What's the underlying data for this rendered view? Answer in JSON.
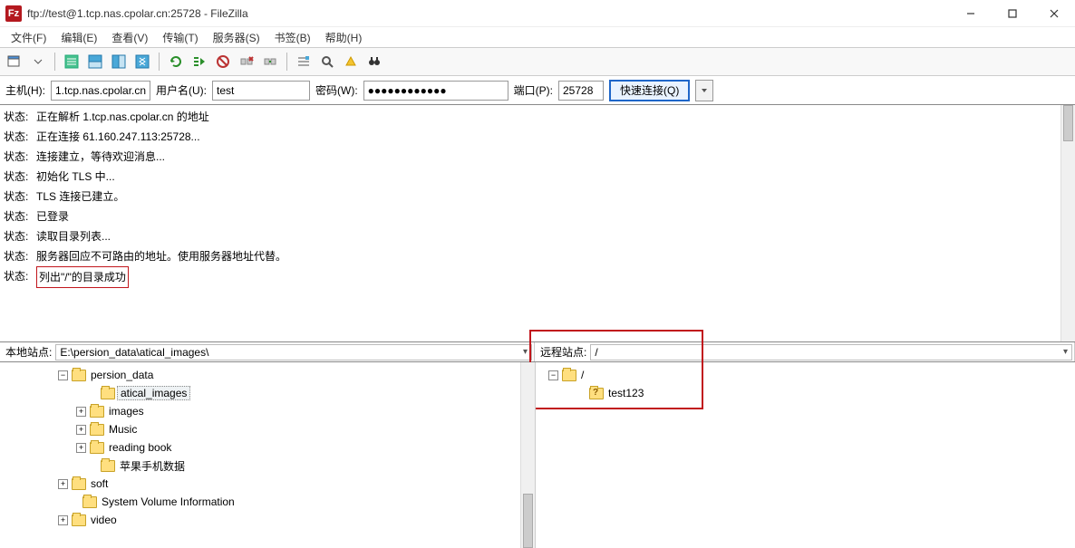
{
  "window": {
    "title": "ftp://test@1.tcp.nas.cpolar.cn:25728 - FileZilla",
    "logo": "Fz"
  },
  "menu": {
    "file": "文件(F)",
    "edit": "编辑(E)",
    "view": "查看(V)",
    "transfer": "传输(T)",
    "server": "服务器(S)",
    "bookmarks": "书签(B)",
    "help": "帮助(H)"
  },
  "quickconnect": {
    "host_label": "主机(H):",
    "host": "1.tcp.nas.cpolar.cn",
    "user_label": "用户名(U):",
    "user": "test",
    "pass_label": "密码(W):",
    "pass": "●●●●●●●●●●●●",
    "port_label": "端口(P):",
    "port": "25728",
    "button": "快速连接(Q)"
  },
  "log": {
    "label": "状态:",
    "lines": [
      "正在解析 1.tcp.nas.cpolar.cn 的地址",
      "正在连接 61.160.247.113:25728...",
      "连接建立，等待欢迎消息...",
      "初始化 TLS 中...",
      "TLS 连接已建立。",
      "已登录",
      "读取目录列表...",
      "服务器回应不可路由的地址。使用服务器地址代替。",
      "列出\"/\"的目录成功"
    ]
  },
  "sites": {
    "local_label": "本地站点:",
    "local_path": "E:\\persion_data\\atical_images\\",
    "remote_label": "远程站点:",
    "remote_path": "/"
  },
  "local_tree": {
    "root": "persion_data",
    "children": [
      "atical_images",
      "images",
      "Music",
      "reading book",
      "苹果手机数据"
    ],
    "siblings": [
      "soft",
      "System Volume Information",
      "video"
    ]
  },
  "remote_tree": {
    "root": "/",
    "children": [
      "test123"
    ]
  }
}
